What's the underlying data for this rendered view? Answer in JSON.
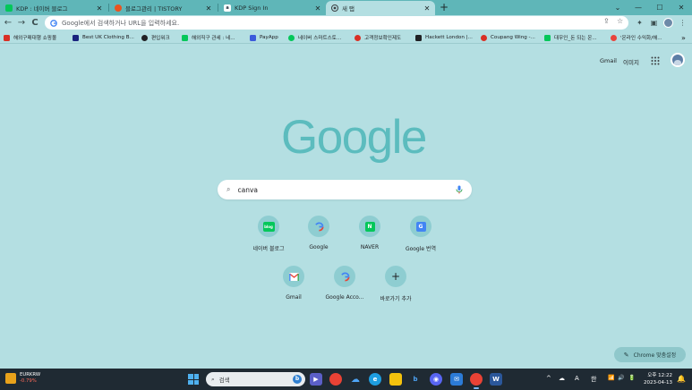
{
  "tabs": [
    {
      "title": "KDP : 네이버 블로그",
      "favicon": "naver-blog-icon",
      "color": "#03c75a",
      "active": false
    },
    {
      "title": "블로그관리 | TISTORY",
      "favicon": "tistory-icon",
      "color": "#eb531f",
      "active": false
    },
    {
      "title": "KDP Sign In",
      "favicon": "amazon-icon",
      "color": "#232f3e",
      "active": false
    },
    {
      "title": "새 탭",
      "favicon": "chrome-icon",
      "color": "#5f6368",
      "active": true
    }
  ],
  "tab_close_glyph": "✕",
  "new_tab_glyph": "+",
  "window_controls": {
    "chevron": "⌄",
    "minimize": "—",
    "maximize": "☐",
    "close": "✕"
  },
  "toolbar": {
    "back": "←",
    "forward": "→",
    "reload": "C",
    "omnibox_placeholder": "Google에서 검색하거나 URL을 입력하세요.",
    "share": "⇪",
    "star": "☆",
    "extensions": "✦",
    "sidebar": "▣",
    "menu": "⋮"
  },
  "bookmarks": [
    {
      "label": "해외구매대행 쇼핑몰",
      "color": "#d93025"
    },
    {
      "label": "Best UK Clothing B...",
      "color": "#1a237e"
    },
    {
      "label": "편입워크",
      "color": "#202124"
    },
    {
      "label": "해외직구 관세 : 네...",
      "color": "#03c75a"
    },
    {
      "label": "PayApp",
      "color": "#3b5bdb"
    },
    {
      "label": "네이버 스마트스토...",
      "color": "#03c75a"
    },
    {
      "label": "고객정보확인제도",
      "color": "#d93025"
    },
    {
      "label": "Hackett London |...",
      "color": "#202124"
    },
    {
      "label": "Coupang Wing -...",
      "color": "#d93025"
    },
    {
      "label": "대우인_돈 되는 온...",
      "color": "#03c75a"
    },
    {
      "label": "'온라인 수익화/해...",
      "color": "#e8453c"
    }
  ],
  "bookmarks_more": "»",
  "header": {
    "gmail": "Gmail",
    "images": "이미지"
  },
  "logo_text": "Google",
  "search": {
    "query": "canva",
    "icon": "⌕"
  },
  "shortcuts": [
    {
      "label": "네이버 블로그",
      "icon": "naver-blog-icon",
      "glyph": "blog",
      "color": "#03c75a"
    },
    {
      "label": "Google",
      "icon": "google-icon",
      "glyph": "G",
      "color": "#ffffff"
    },
    {
      "label": "NAVER",
      "icon": "naver-icon",
      "glyph": "N",
      "color": "#03c75a"
    },
    {
      "label": "Google 번역",
      "icon": "google-translate-icon",
      "glyph": "G",
      "color": "#4285f4"
    },
    {
      "label": "Gmail",
      "icon": "gmail-icon",
      "glyph": "M",
      "color": "#ffffff"
    },
    {
      "label": "Google Acco...",
      "icon": "google-icon",
      "glyph": "G",
      "color": "#ffffff"
    },
    {
      "label": "바로가기 추가",
      "icon": "plus-icon",
      "glyph": "+",
      "color": "#8ecdd1"
    }
  ],
  "customize_label": "Chrome 맞춤설정",
  "taskbar": {
    "weather_title": "EURKRW",
    "weather_sub": "-0.79%",
    "search_placeholder": "검색",
    "bing_glyph": "b",
    "tray_glyphs": [
      "^",
      "☁",
      "A",
      "한",
      "📶",
      "🔊",
      "🔋"
    ],
    "time": "오후 12:22",
    "date": "2023-04-13",
    "notification_glyph": "🔔"
  },
  "taskbar_apps": [
    {
      "name": "teams-icon",
      "glyph": "T",
      "color": "#5b5fc7"
    },
    {
      "name": "chrome-icon",
      "glyph": "",
      "color": "#e94235"
    },
    {
      "name": "onedrive-icon",
      "glyph": "☁",
      "color": "#1a73e8"
    },
    {
      "name": "edge-icon",
      "glyph": "e",
      "color": "#1e9ee0"
    },
    {
      "name": "file-explorer-icon",
      "glyph": "",
      "color": "#f4c20d"
    },
    {
      "name": "photos-icon",
      "glyph": "",
      "color": "#2c9ad6"
    },
    {
      "name": "bing-icon",
      "glyph": "b",
      "color": "#1f2a33"
    },
    {
      "name": "discord-icon",
      "glyph": "◉",
      "color": "#5865f2"
    },
    {
      "name": "kakaotalk-icon",
      "glyph": "✉",
      "color": "#2c7bd6"
    },
    {
      "name": "chrome-active-icon",
      "glyph": "",
      "color": "#e94235"
    },
    {
      "name": "word-icon",
      "glyph": "W",
      "color": "#2b579a"
    }
  ]
}
